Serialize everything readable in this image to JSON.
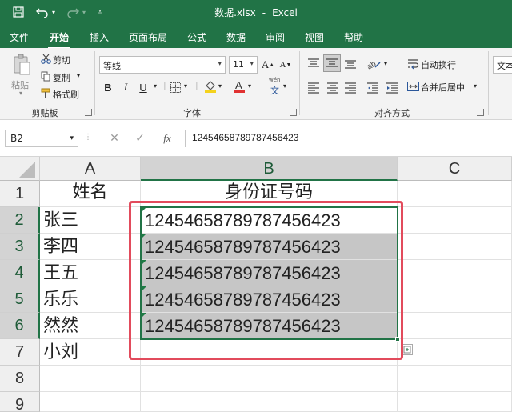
{
  "window": {
    "file_name": "数据.xlsx",
    "separator": "-",
    "app_name": "Excel"
  },
  "tabs": [
    "文件",
    "开始",
    "插入",
    "页面布局",
    "公式",
    "数据",
    "审阅",
    "视图",
    "帮助"
  ],
  "active_tab": "开始",
  "ribbon": {
    "clipboard": {
      "paste": "粘贴",
      "cut": "剪切",
      "copy": "复制",
      "format_painter": "格式刷",
      "label": "剪贴板"
    },
    "font": {
      "name": "等线",
      "size": "11",
      "bold": "B",
      "italic": "I",
      "underline": "U",
      "grow": "A",
      "shrink": "A",
      "phonetic": "wén",
      "phonetic_char": "文",
      "label": "字体"
    },
    "alignment": {
      "wrap": "自动换行",
      "merge": "合并后居中",
      "label": "对齐方式"
    },
    "number": {
      "format": "文本"
    }
  },
  "formula_bar": {
    "name_box": "B2",
    "fx": "fx",
    "value": "1245465878978745642​3"
  },
  "colors": {
    "excel_green": "#217346",
    "highlight_red": "#e24b5c",
    "selection_gray": "#c6c6c6"
  },
  "sheet": {
    "columns": [
      "A",
      "B",
      "C"
    ],
    "rows": [
      "1",
      "2",
      "3",
      "4",
      "5",
      "6",
      "7",
      "8",
      "9"
    ],
    "cells": {
      "A1": "姓名",
      "B1": "身份证号码",
      "A2": "张三",
      "B2": "124546587897874564​23",
      "A3": "李四",
      "B3": "124546587897874564​23",
      "A4": "王五",
      "B4": "124546587897874564​23",
      "A5": "乐乐",
      "B5": "124546587897874564​23",
      "A6": "然然",
      "B6": "124546587897874564​23",
      "A7": "小刘"
    }
  }
}
